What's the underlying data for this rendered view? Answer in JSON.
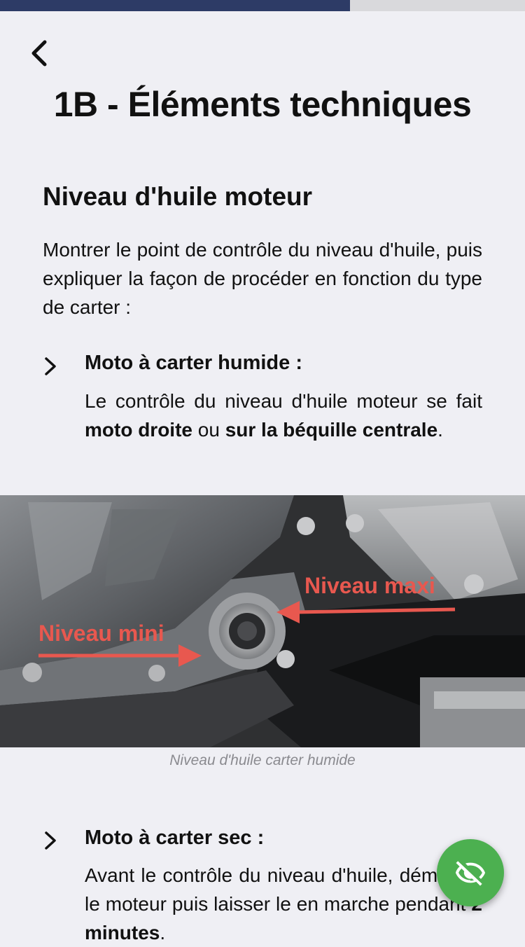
{
  "progress": {
    "fraction": 0.667
  },
  "header": {
    "back_icon": "chevron-left-icon",
    "title": "1B - Éléments techniques"
  },
  "section": {
    "heading": "Niveau d'huile moteur",
    "intro": "Montrer le point de contrôle du niveau d'huile, puis expliquer la façon de procéder en fonction du type de carter :"
  },
  "bullet1": {
    "icon": "chevron-right-icon",
    "title": "Moto à carter humide :",
    "text_before": "Le contrôle du niveau d'huile moteur se fait ",
    "bold1": "moto droite",
    "mid": " ou ",
    "bold2": "sur la béquille centrale",
    "text_after": "."
  },
  "photo": {
    "label_max": "Niveau maxi",
    "label_min": "Niveau mini",
    "caption": "Niveau d'huile carter humide"
  },
  "bullet2": {
    "icon": "chevron-right-icon",
    "title": "Moto à carter sec :",
    "text_before": "Avant le contrôle du niveau d'huile, démarrez le moteur puis laisser le en marche pendant ",
    "bold1": "2 minutes",
    "text_after": "."
  },
  "fab": {
    "icon": "eye-off-icon",
    "color": "#4cb050"
  },
  "colors": {
    "progress": "#2d3b66",
    "accent_label": "#e8584f",
    "background": "#efeff4"
  }
}
